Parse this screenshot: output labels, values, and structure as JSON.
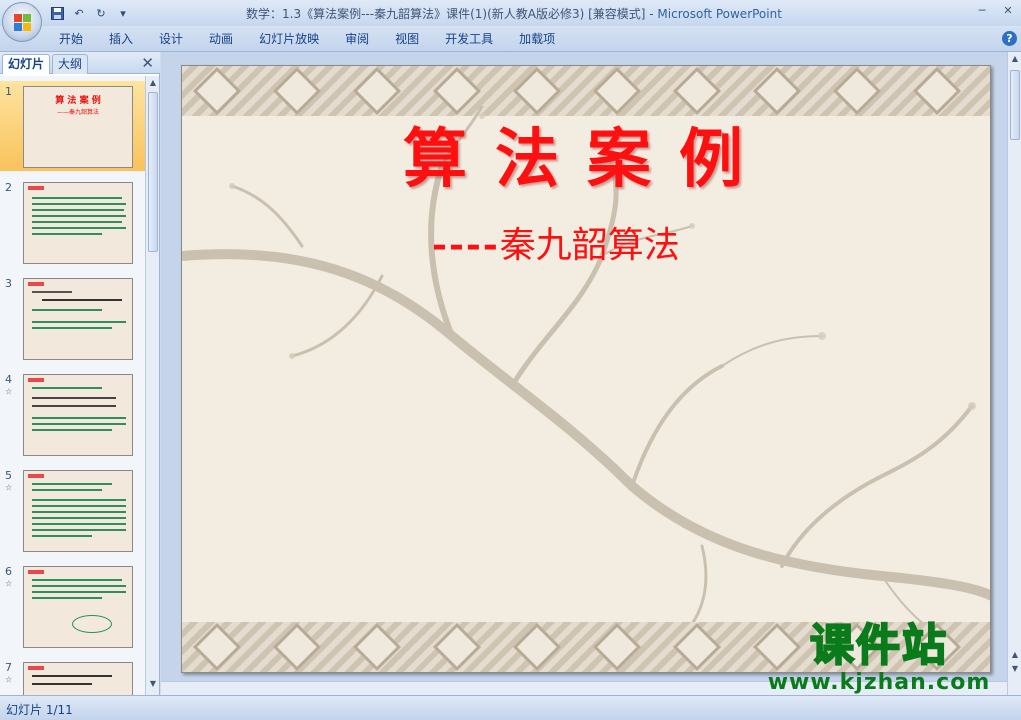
{
  "window": {
    "title_prefix": "数学：1.3《算法案例---秦九韶算法》课件(1)(新人教A版必修3) [兼容模式] - ",
    "title_app": "Microsoft PowerPoint",
    "minimize_label": "─",
    "close_label": "✕"
  },
  "quick_access": {
    "save_icon": "save-icon",
    "undo_label": "↶",
    "redo_label": "↻",
    "customize_label": "▾"
  },
  "ribbon": {
    "tabs": [
      {
        "label": "开始"
      },
      {
        "label": "插入"
      },
      {
        "label": "设计"
      },
      {
        "label": "动画"
      },
      {
        "label": "幻灯片放映"
      },
      {
        "label": "审阅"
      },
      {
        "label": "视图"
      },
      {
        "label": "开发工具"
      },
      {
        "label": "加载项"
      }
    ],
    "help_label": "?"
  },
  "left_pane": {
    "tab_slides": "幻灯片",
    "tab_outline": "大纲",
    "close_label": "✕",
    "thumbnails": [
      {
        "number": "1",
        "title": "算 法 案 例",
        "subtitle": "——秦九韶算法",
        "star": ""
      },
      {
        "number": "2",
        "star": ""
      },
      {
        "number": "3",
        "star": ""
      },
      {
        "number": "4",
        "star": "☆"
      },
      {
        "number": "5",
        "star": "☆"
      },
      {
        "number": "6",
        "star": "☆"
      },
      {
        "number": "7",
        "star": "☆"
      }
    ]
  },
  "slide": {
    "title": "算法案例",
    "subtitle_dash": "----",
    "subtitle_text": "秦九韶算法",
    "background_color": "#f3ece1",
    "title_color": "#ff1010"
  },
  "watermark": {
    "cn": "课件站",
    "url": "www.kjzhan.com"
  },
  "status": {
    "slide_info": "幻灯片 1/11"
  },
  "colors": {
    "accent": "#15428b",
    "selection": "#f9c25b"
  }
}
